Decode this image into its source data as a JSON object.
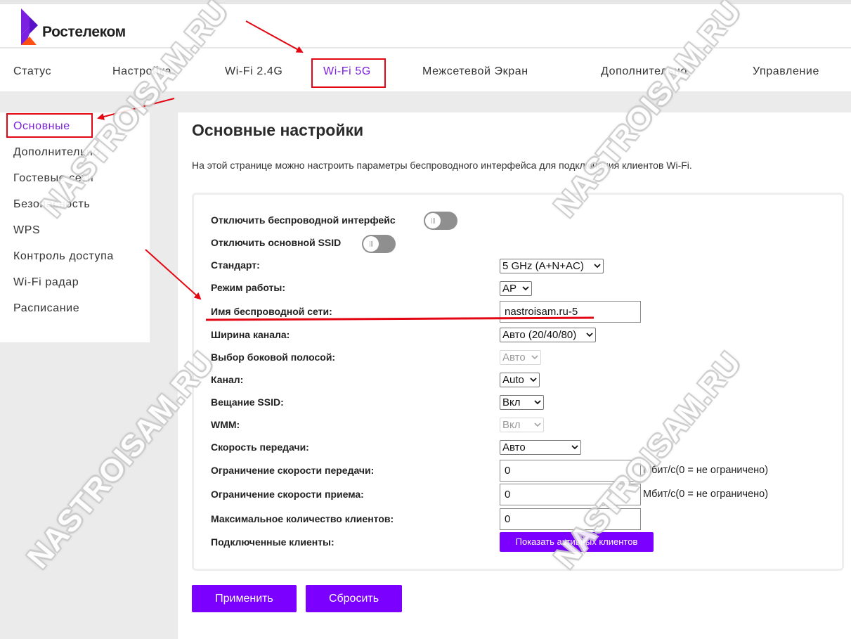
{
  "brand": {
    "name": "Ростелеком",
    "logo_color_top": "#7b1fe0",
    "logo_color_bottom": "#ff4f12"
  },
  "nav": {
    "items": [
      {
        "label": "Статус"
      },
      {
        "label": "Настройка"
      },
      {
        "label": "Wi-Fi 2.4G"
      },
      {
        "label": "Wi-Fi 5G",
        "active": true
      },
      {
        "label": "Межсетевой Экран"
      },
      {
        "label": "Дополнительно"
      },
      {
        "label": "Управление"
      }
    ]
  },
  "sidebar": {
    "items": [
      {
        "label": "Основные",
        "active": true
      },
      {
        "label": "Дополнительно"
      },
      {
        "label": "Гостевые сети"
      },
      {
        "label": "Безопасность"
      },
      {
        "label": "WPS"
      },
      {
        "label": "Контроль доступа"
      },
      {
        "label": "Wi-Fi радар"
      },
      {
        "label": "Расписание"
      }
    ]
  },
  "page": {
    "title": "Основные настройки",
    "description": "На этой странице можно настроить параметры беспроводного интерфейса для подключения клиентов Wi-Fi."
  },
  "form": {
    "disable_wireless": {
      "label": "Отключить беспроводной интерфейс",
      "state": "off"
    },
    "disable_main_ssid": {
      "label": "Отключить основной SSID",
      "state": "off"
    },
    "standard": {
      "label": "Стандарт:",
      "value": "5 GHz (A+N+AC)"
    },
    "mode": {
      "label": "Режим работы:",
      "value": "AP"
    },
    "ssid": {
      "label": "Имя беспроводной сети:",
      "value": "nastroisam.ru-5"
    },
    "channel_width": {
      "label": "Ширина канала:",
      "value": "Авто (20/40/80)"
    },
    "sideband": {
      "label": "Выбор боковой полосой:",
      "value": "Авто",
      "disabled": true
    },
    "channel": {
      "label": "Канал:",
      "value": "Auto"
    },
    "ssid_broadcast": {
      "label": "Вещание SSID:",
      "value": "Вкл"
    },
    "wmm": {
      "label": "WMM:",
      "value": "Вкл",
      "disabled": true
    },
    "tx_rate": {
      "label": "Скорость передачи:",
      "value": "Авто"
    },
    "tx_limit": {
      "label": "Ограничение скорости передачи:",
      "value": "0",
      "unit": "Мбит/с(0 = не ограничено)"
    },
    "rx_limit": {
      "label": "Ограничение скорости приема:",
      "value": "0",
      "unit": "Мбит/с(0 = не ограничено)"
    },
    "max_clients": {
      "label": "Максимальное количество клиентов:",
      "value": "0"
    },
    "connected_clients": {
      "label": "Подключенные клиенты:",
      "button": "Показать активных клиентов"
    }
  },
  "actions": {
    "apply": "Применить",
    "reset": "Сбросить"
  },
  "watermark": "NASTROISAM.RU",
  "colors": {
    "accent": "#7b00ff",
    "active_text": "#7b1fe0",
    "annotation_red": "#e30613"
  }
}
